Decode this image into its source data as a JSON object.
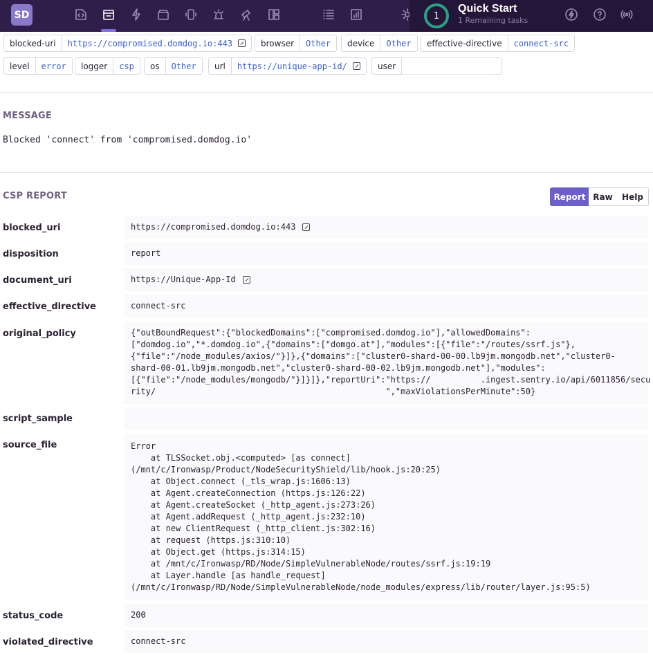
{
  "nav": {
    "avatar": "SD",
    "icons": [
      "code-icon",
      "issues-icon",
      "performance-icon",
      "releases-icon",
      "user-feedback-icon",
      "alerts-icon",
      "discover-icon",
      "dashboards-icon",
      "projects-list-icon",
      "stats-icon",
      "settings-icon"
    ],
    "quick_start": {
      "count": "1",
      "title": "Quick Start",
      "subtitle": "1 Remaining tasks"
    },
    "right_icons": [
      "broadcast-icon",
      "help-icon",
      "radio-icon"
    ]
  },
  "tags": [
    {
      "key": "blocked-uri",
      "value": "https://compromised.domdog.io:443",
      "link": true
    },
    {
      "key": "browser",
      "value": "Other"
    },
    {
      "key": "device",
      "value": "Other"
    },
    {
      "key": "effective-directive",
      "value": "connect-src"
    },
    {
      "key": "level",
      "value": "error"
    },
    {
      "key": "logger",
      "value": "csp"
    },
    {
      "key": "os",
      "value": "Other"
    },
    {
      "key": "url",
      "value": "https://unique-app-id/",
      "link": true
    },
    {
      "key": "user",
      "value": ""
    }
  ],
  "message": {
    "heading": "MESSAGE",
    "text": "Blocked 'connect' from 'compromised.domdog.io'"
  },
  "csp": {
    "heading": "CSP REPORT",
    "buttons": [
      "Report",
      "Raw",
      "Help"
    ],
    "rows": {
      "blocked_uri": {
        "key": "blocked_uri",
        "value": "https://compromised.domdog.io:443"
      },
      "disposition": {
        "key": "disposition",
        "value": "report"
      },
      "document_uri": {
        "key": "document_uri",
        "value": "https://Unique-App-Id"
      },
      "effective_directive": {
        "key": "effective_directive",
        "value": "connect-src"
      },
      "original_policy": {
        "key": "original_policy",
        "lines": [
          "{\"outBoundRequest\":{\"blockedDomains\":[\"compromised.domdog.io\"],\"allowedDomains\":",
          "[\"domdog.io\",\"*.domdog.io\",{\"domains\":[\"domgo.at\"],\"modules\":[{\"file\":\"/routes/ssrf.js\"},",
          "{\"file\":\"/node_modules/axios/\"}]},{\"domains\":[\"cluster0-shard-00-00.lb9jm.mongodb.net\",\"cluster0-",
          "shard-00-01.lb9jm.mongodb.net\",\"cluster0-shard-00-02.lb9jm.mongodb.net\"],\"modules\":",
          "[{\"file\":\"/node_modules/mongodb/\"}]}]},\"reportUri\":\"https://          .ingest.sentry.io/api/6011856/secu",
          "rity/                                              \",\"maxViolationsPerMinute\":50}"
        ]
      },
      "script_sample": {
        "key": "script_sample",
        "value": ""
      },
      "source_file": {
        "key": "source_file",
        "lines": [
          "Error",
          "    at TLSSocket.obj.<computed> [as connect]",
          "(/mnt/c/Ironwasp/Product/NodeSecurityShield/lib/hook.js:20:25)",
          "    at Object.connect (_tls_wrap.js:1606:13)",
          "    at Agent.createConnection (https.js:126:22)",
          "    at Agent.createSocket (_http_agent.js:273:26)",
          "    at Agent.addRequest (_http_agent.js:232:10)",
          "    at new ClientRequest (_http_client.js:302:16)",
          "    at request (https.js:310:10)",
          "    at Object.get (https.js:314:15)",
          "    at /mnt/c/Ironwasp/RD/Node/SimpleVulnerableNode/routes/ssrf.js:19:19",
          "    at Layer.handle [as handle_request]",
          "(/mnt/c/Ironwasp/RD/Node/SimpleVulnerableNode/node_modules/express/lib/router/layer.js:95:5)"
        ]
      },
      "status_code": {
        "key": "status_code",
        "value": "200"
      },
      "violated_directive": {
        "key": "violated_directive",
        "value": "connect-src"
      }
    }
  },
  "colors": {
    "nav_bg": "#2f1d4a",
    "accent": "#6c5fc7",
    "link": "#3d5fd1",
    "quick_start_ring": "#2ba185"
  }
}
